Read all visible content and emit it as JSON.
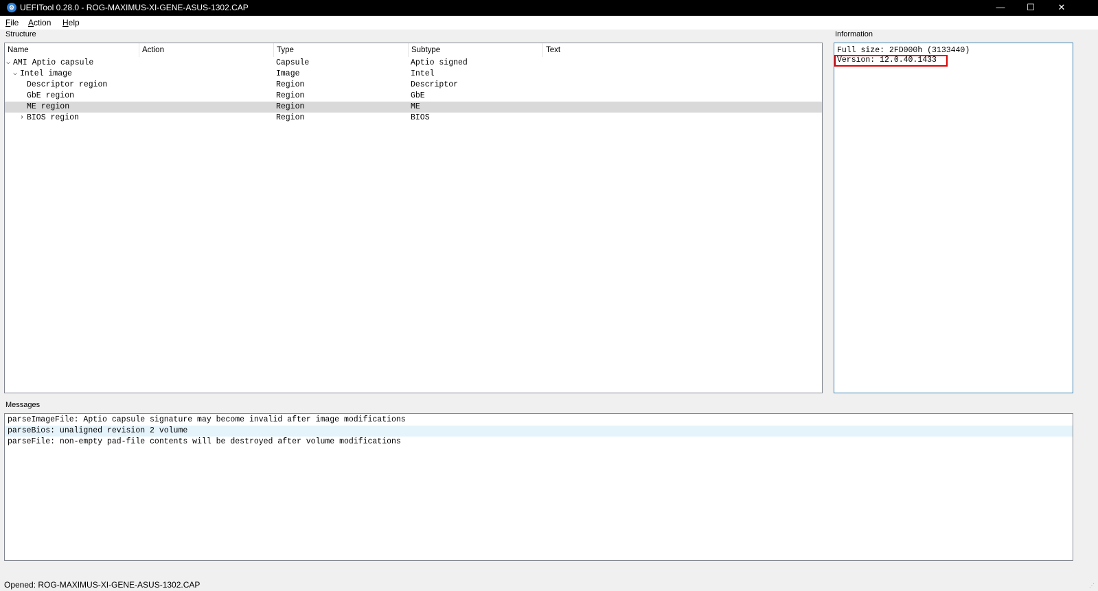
{
  "window": {
    "title": "UEFITool 0.28.0 - ROG-MAXIMUS-XI-GENE-ASUS-1302.CAP",
    "app_icon": "uefitool-app-icon",
    "controls": {
      "minimize": "—",
      "maximize": "☐",
      "close": "✕"
    }
  },
  "menu": [
    {
      "first": "F",
      "rest": "ile"
    },
    {
      "first": "A",
      "rest": "ction"
    },
    {
      "first": "H",
      "rest": "elp"
    }
  ],
  "structure": {
    "label": "Structure",
    "columns": [
      "Name",
      "Action",
      "Type",
      "Subtype",
      "Text"
    ],
    "rows": [
      {
        "name": "AMI Aptio capsule",
        "action": "",
        "type": "Capsule",
        "subtype": "Aptio signed",
        "text": "",
        "expander": "expanded",
        "level": 0
      },
      {
        "name": "Intel image",
        "action": "",
        "type": "Image",
        "subtype": "Intel",
        "text": "",
        "expander": "expanded",
        "level": 1
      },
      {
        "name": "Descriptor region",
        "action": "",
        "type": "Region",
        "subtype": "Descriptor",
        "text": "",
        "expander": "none",
        "level": 2
      },
      {
        "name": "GbE region",
        "action": "",
        "type": "Region",
        "subtype": "GbE",
        "text": "",
        "expander": "none",
        "level": 2
      },
      {
        "name": "ME region",
        "action": "",
        "type": "Region",
        "subtype": "ME",
        "text": "",
        "expander": "none",
        "level": 2,
        "selected": true
      },
      {
        "name": "BIOS region",
        "action": "",
        "type": "Region",
        "subtype": "BIOS",
        "text": "",
        "expander": "collapsed",
        "level": 2
      }
    ]
  },
  "information": {
    "label": "Information",
    "lines": [
      "Full size: 2FD000h (3133440)",
      "Version: 12.0.40.1433"
    ],
    "highlight_color": "#e00000"
  },
  "messages": {
    "label": "Messages",
    "items": [
      "parseImageFile: Aptio capsule signature may become invalid after image modifications",
      "parseBios: unaligned revision 2 volume",
      "parseFile: non-empty pad-file contents will be destroyed after volume modifications"
    ]
  },
  "status": {
    "text": "Opened: ROG-MAXIMUS-XI-GENE-ASUS-1302.CAP"
  },
  "colors": {
    "titlebar": "#000000",
    "selection": "#d9d9d9",
    "message_hover": "#e5f3fb",
    "info_border": "#3c7fb1"
  }
}
